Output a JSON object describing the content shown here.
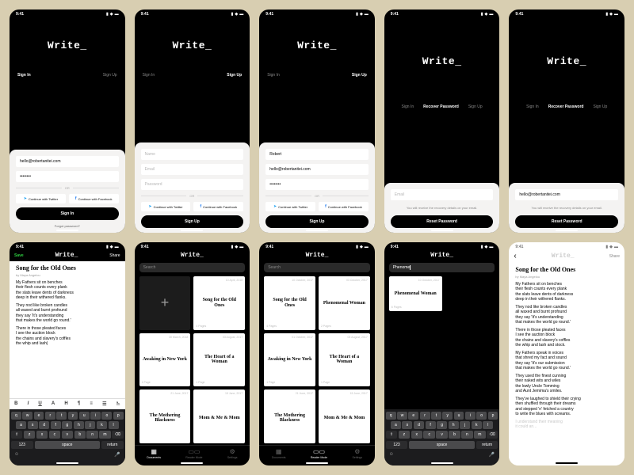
{
  "status": {
    "time": "9:41",
    "signal": "▪▪▪▪",
    "wifi": "◉",
    "battery": "▮"
  },
  "brand": "Write_",
  "auth": {
    "tabs": {
      "signin": "Sign In",
      "signup": "Sign Up",
      "recover": "Recover Password"
    },
    "email_value": "hello@robertanitei.com",
    "password_dots": "••••••••",
    "name_value": "Robert",
    "placeholders": {
      "name": "Name",
      "email": "Email",
      "password": "Password"
    },
    "or": "OR",
    "twitter": "Continue with Twitter",
    "facebook": "Continue with Facebook",
    "signin_btn": "Sign In",
    "signup_btn": "Sign Up",
    "reset_btn": "Reset Password",
    "forgot": "Forgot password?",
    "recover_note": "You will receive the recovery details on your email."
  },
  "editor": {
    "save": "Save",
    "share": "Share",
    "title": "Song for the Old Ones",
    "byline": "by Maya Angelou",
    "p1": "My Fathers sit on benches\ntheir flesh counts every plank\nthe slats leave dents of darkness\ndeep in their withered flanks.",
    "p2": "They nod like broken candles\nall waxed and burnt profound\nthey say 'It's understanding\nthat makes the world go round.'",
    "p3": "There in those pleated faces\nI see the auction block\nthe chains and slavery's coffles\nthe whip and lash|",
    "p3_full": "There in those pleated faces\nI see the auction block\nthe chains and slavery's coffles\nthe whip and lash and stock.",
    "p4": "My Fathers speak in voices\nthat shred my fact and sound\nthey say 'It's our submission\nthat makes the world go round.'",
    "p5": "They used the finest cunning\ntheir naked wits and wiles\nthe lowly Uncle Tomming\nand Aunt Jemima's smiles.",
    "p6": "They've laughed to shield their crying\nthen shuffled through their dreams\nand stepped 'n' fetched a country\nto write the blues with screams.",
    "p7_muted": "I understand their meaning\nit could an...",
    "format_icons": [
      "B",
      "I",
      "U",
      "A",
      "H",
      "¶",
      "≡",
      "☰",
      "⎁"
    ]
  },
  "keyboard": {
    "row1": [
      "q",
      "w",
      "e",
      "r",
      "t",
      "y",
      "u",
      "i",
      "o",
      "p"
    ],
    "row2": [
      "a",
      "s",
      "d",
      "f",
      "g",
      "h",
      "j",
      "k",
      "l"
    ],
    "row3": [
      "⇧",
      "z",
      "x",
      "c",
      "v",
      "b",
      "n",
      "m",
      "⌫"
    ],
    "bottom": {
      "num": "123",
      "space": "space",
      "ret": "return"
    }
  },
  "library": {
    "search_placeholder": "Search",
    "search_typed": "Phenome",
    "docs": [
      {
        "date": "10 April, 2018",
        "title": "Song for the Old Ones",
        "pages": "4 Pages"
      },
      {
        "date": "30 March, 2018",
        "title": "Awaking in New York",
        "pages": "1 Page"
      },
      {
        "date": "03 August, 2017",
        "title": "The Heart of a Woman",
        "pages": "1 Page"
      },
      {
        "date": "21 June, 2017",
        "title": "The Mothering Blackness",
        "pages": ""
      },
      {
        "date": "15 June, 2017",
        "title": "Mom & Me & Mom",
        "pages": ""
      }
    ],
    "docs2": [
      {
        "date": "10 October, 2017",
        "title": "Song for the Old Ones",
        "pages": "4 Pages"
      },
      {
        "date": "03 October, 2017",
        "title": "Phenomenal Woman",
        "pages": "2 Pages"
      },
      {
        "date": "01 October, 2017",
        "title": "Awaking in New York",
        "pages": "1 Page"
      },
      {
        "date": "03 August, 2017",
        "title": "The Heart of a Woman",
        "pages": "1 Page"
      },
      {
        "date": "21 June, 2017",
        "title": "The Mothering Blackness",
        "pages": ""
      },
      {
        "date": "15 June, 2017",
        "title": "Mom & Me & Mom",
        "pages": ""
      }
    ],
    "search_result": {
      "date": "10 October, 2017",
      "title": "Phenomenal Woman",
      "pages": "6 Pages"
    },
    "tabs": {
      "documents": "Documents",
      "reader": "Reader Mode",
      "settings": "Settings"
    }
  }
}
